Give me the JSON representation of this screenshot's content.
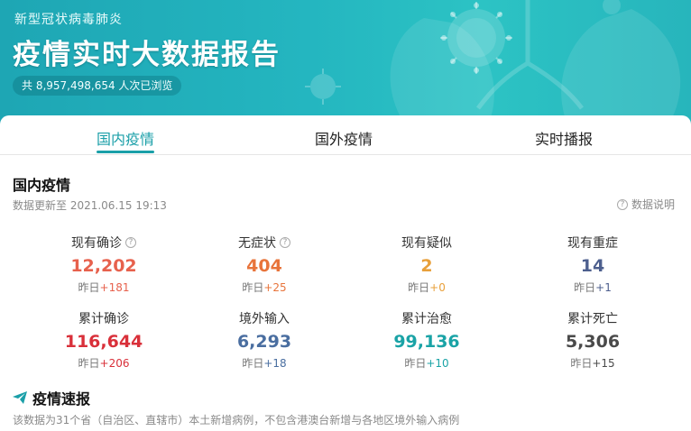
{
  "banner": {
    "subtitle": "新型冠状病毒肺炎",
    "title": "疫情实时大数据报告",
    "views": "共 8,957,498,654 人次已浏览"
  },
  "tabs": [
    {
      "label": "国内疫情",
      "active": true
    },
    {
      "label": "国外疫情",
      "active": false
    },
    {
      "label": "实时播报",
      "active": false
    }
  ],
  "section": {
    "title": "国内疫情",
    "updated": "数据更新至 2021.06.15 19:13",
    "explain": "数据说明"
  },
  "stats": [
    {
      "label": "现有确诊",
      "value": "12,202",
      "delta_prefix": "昨日",
      "delta": "+181",
      "value_color": "#e7614d",
      "delta_color": "#e7614d",
      "has_help": true
    },
    {
      "label": "无症状",
      "value": "404",
      "delta_prefix": "昨日",
      "delta": "+25",
      "value_color": "#e8743b",
      "delta_color": "#e8743b",
      "has_help": true
    },
    {
      "label": "现有疑似",
      "value": "2",
      "delta_prefix": "昨日",
      "delta": "+0",
      "value_color": "#e8a03b",
      "delta_color": "#e8a03b",
      "has_help": false
    },
    {
      "label": "现有重症",
      "value": "14",
      "delta_prefix": "昨日",
      "delta": "+1",
      "value_color": "#4d5f8e",
      "delta_color": "#4d5f8e",
      "has_help": false
    },
    {
      "label": "累计确诊",
      "value": "116,644",
      "delta_prefix": "昨日",
      "delta": "+206",
      "value_color": "#d9303a",
      "delta_color": "#d9303a",
      "has_help": false
    },
    {
      "label": "境外输入",
      "value": "6,293",
      "delta_prefix": "昨日",
      "delta": "+18",
      "value_color": "#4a6ea0",
      "delta_color": "#4a6ea0",
      "has_help": false
    },
    {
      "label": "累计治愈",
      "value": "99,136",
      "delta_prefix": "昨日",
      "delta": "+10",
      "value_color": "#1aa3a6",
      "delta_color": "#1aa3a6",
      "has_help": false
    },
    {
      "label": "累计死亡",
      "value": "5,306",
      "delta_prefix": "昨日",
      "delta": "+15",
      "value_color": "#4a4a4a",
      "delta_color": "#4a4a4a",
      "has_help": false
    }
  ],
  "news": {
    "title": "疫情速报",
    "note": "该数据为31个省（自治区、直辖市）本土新增病例，不包含港澳台新增与各地区境外输入病例"
  },
  "colors": {
    "accent": "#1a9fa8",
    "banner": "#24b6c0"
  }
}
